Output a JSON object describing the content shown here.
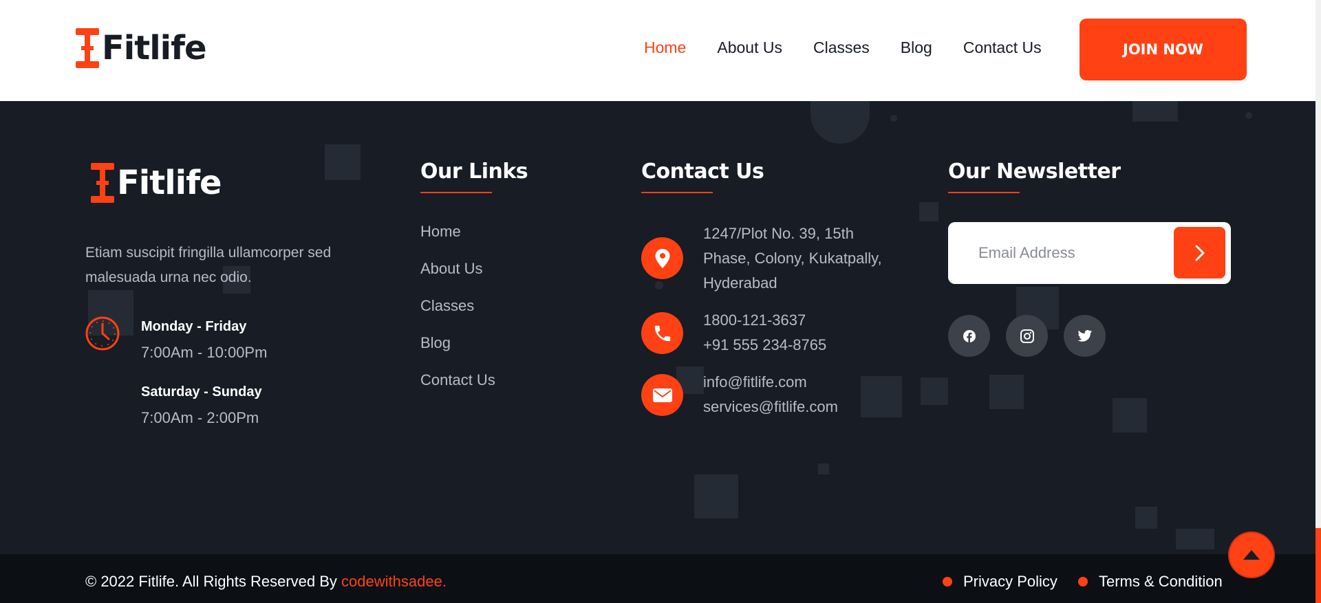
{
  "brand": {
    "name": "Fitlife",
    "accent": "#ff4114",
    "dark": "#171c25"
  },
  "header": {
    "nav": [
      "Home",
      "About Us",
      "Classes",
      "Blog",
      "Contact Us"
    ],
    "active_nav": "Home",
    "cta_label": "JOIN NOW"
  },
  "about": {
    "description": "Etiam suscipit fringilla ullamcorper sed malesuada urna nec odio.",
    "hours": [
      {
        "days": "Monday - Friday",
        "time": "7:00Am - 10:00Pm"
      },
      {
        "days": "Saturday - Sunday",
        "time": "7:00Am - 2:00Pm"
      }
    ],
    "clock_icon": "clock-icon"
  },
  "links": {
    "heading": "Our Links",
    "items": [
      "Home",
      "About Us",
      "Classes",
      "Blog",
      "Contact Us"
    ]
  },
  "contact": {
    "heading": "Contact Us",
    "address": [
      "1247/Plot No. 39, 15th",
      "Phase, Colony, Kukatpally,",
      "Hyderabad"
    ],
    "phones": [
      "1800-121-3637",
      "+91 555 234-8765"
    ],
    "emails": [
      "info@fitlife.com",
      "services@fitlife.com"
    ],
    "icons": [
      "location-pin-icon",
      "phone-icon",
      "mail-icon"
    ]
  },
  "newsletter": {
    "heading": "Our Newsletter",
    "placeholder": "Email Address",
    "submit_icon": "chevron-right-icon",
    "socials": [
      "facebook-icon",
      "instagram-icon",
      "twitter-icon"
    ]
  },
  "bottom": {
    "copyright": "© 2022 Fitlife. All Rights Reserved By ",
    "author": "codewithsadee.",
    "privacy": "Privacy Policy",
    "terms": "Terms & Condition",
    "back_to_top_icon": "caret-up-icon"
  }
}
